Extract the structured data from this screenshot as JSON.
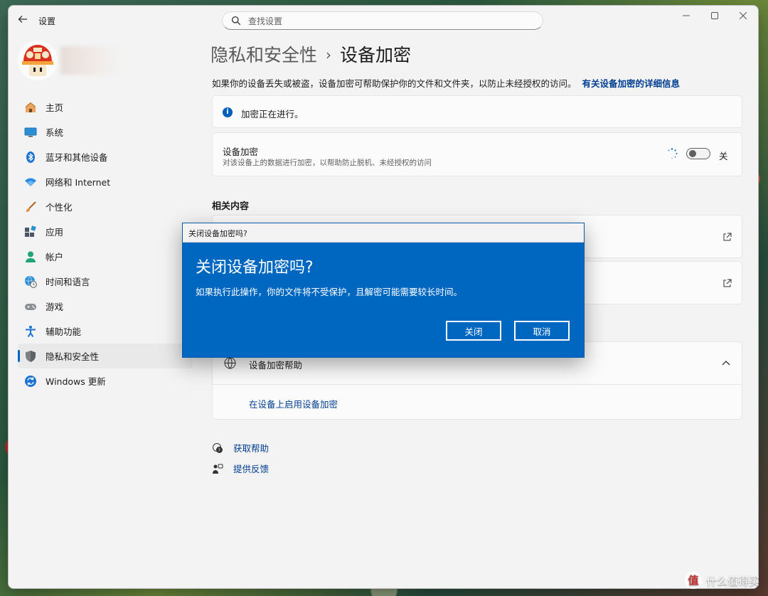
{
  "window": {
    "app_title": "设置",
    "search_placeholder": "查找设置"
  },
  "sidebar": {
    "items": [
      {
        "label": "主页",
        "icon": "home-icon"
      },
      {
        "label": "系统",
        "icon": "monitor-icon"
      },
      {
        "label": "蓝牙和其他设备",
        "icon": "bluetooth-icon"
      },
      {
        "label": "网络和 Internet",
        "icon": "wifi-icon"
      },
      {
        "label": "个性化",
        "icon": "brush-icon"
      },
      {
        "label": "应用",
        "icon": "apps-icon"
      },
      {
        "label": "帐户",
        "icon": "account-icon"
      },
      {
        "label": "时间和语言",
        "icon": "globe-clock-icon"
      },
      {
        "label": "游戏",
        "icon": "gamepad-icon"
      },
      {
        "label": "辅助功能",
        "icon": "accessibility-icon"
      },
      {
        "label": "隐私和安全性",
        "icon": "shield-icon",
        "selected": true
      },
      {
        "label": "Windows 更新",
        "icon": "update-icon"
      }
    ]
  },
  "main": {
    "breadcrumb_parent": "隐私和安全性",
    "breadcrumb_separator": "›",
    "page_title": "设备加密",
    "description": "如果你的设备丢失或被盗，设备加密可帮助保护你的文件和文件夹，以防止未经授权的访问。",
    "description_link": "有关设备加密的详细信息",
    "status_text": "加密正在进行。",
    "encryption_title": "设备加密",
    "encryption_sub": "对该设备上的数据进行加密，以帮助防止脱机、未经授权的访问",
    "toggle_state": "关",
    "related_title": "相关内容",
    "help_card_title": "设备加密帮助",
    "help_card_link": "在设备上启用设备加密",
    "get_help": "获取帮助",
    "feedback": "提供反馈"
  },
  "dialog": {
    "window_title": "关闭设备加密吗?",
    "heading": "关闭设备加密吗?",
    "message": "如果执行此操作，你的文件将不受保护，且解密可能需要较长时间。",
    "confirm_label": "关闭",
    "cancel_label": "取消"
  },
  "watermark": {
    "logo_char": "值",
    "text": "什么值得买"
  },
  "colors": {
    "accent": "#0067c0",
    "link": "#003e92",
    "window_bg": "#f3f3f3"
  }
}
